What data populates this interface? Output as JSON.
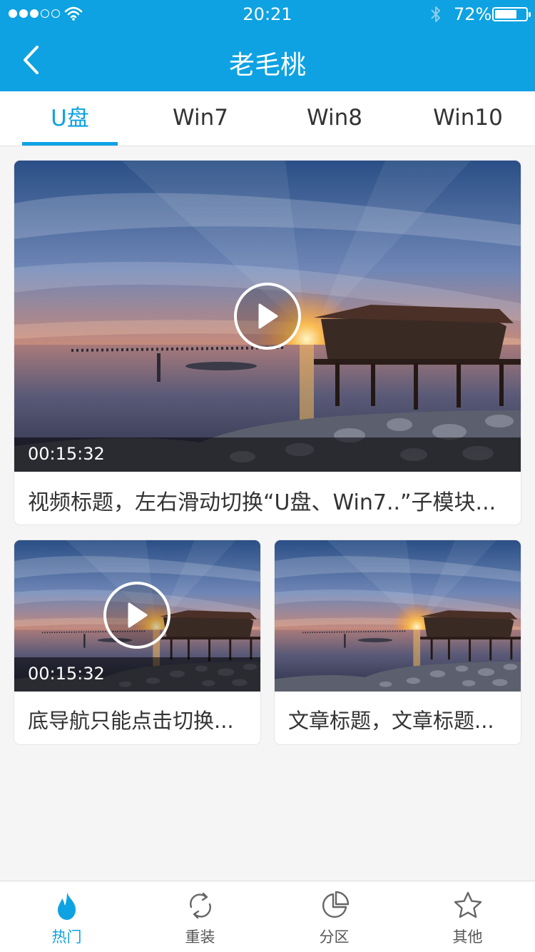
{
  "status_bar": {
    "time": "20:21",
    "battery_percent": "72%",
    "battery_level": 0.72,
    "signal_bars_filled": 3,
    "signal_bars_total": 5
  },
  "nav": {
    "title": "老毛桃",
    "back_icon": "chevron-left-icon"
  },
  "tabs": [
    {
      "label": "U盘",
      "active": true
    },
    {
      "label": "Win7",
      "active": false
    },
    {
      "label": "Win8",
      "active": false
    },
    {
      "label": "Win10",
      "active": false
    }
  ],
  "cards": {
    "featured": {
      "duration": "00:15:32",
      "title": "视频标题，左右滑动切换“U盘、Win7..”子模块..."
    },
    "left": {
      "duration": "00:15:32",
      "title": "底导航只能点击切换..."
    },
    "right": {
      "title": "文章标题，文章标题..."
    }
  },
  "tabbar": [
    {
      "label": "热门",
      "icon": "flame-icon",
      "active": true
    },
    {
      "label": "重装",
      "icon": "refresh-icon",
      "active": false
    },
    {
      "label": "分区",
      "icon": "pie-chart-icon",
      "active": false
    },
    {
      "label": "其他",
      "icon": "star-icon",
      "active": false
    }
  ],
  "colors": {
    "accent": "#0ea2e2",
    "text": "#333333"
  }
}
